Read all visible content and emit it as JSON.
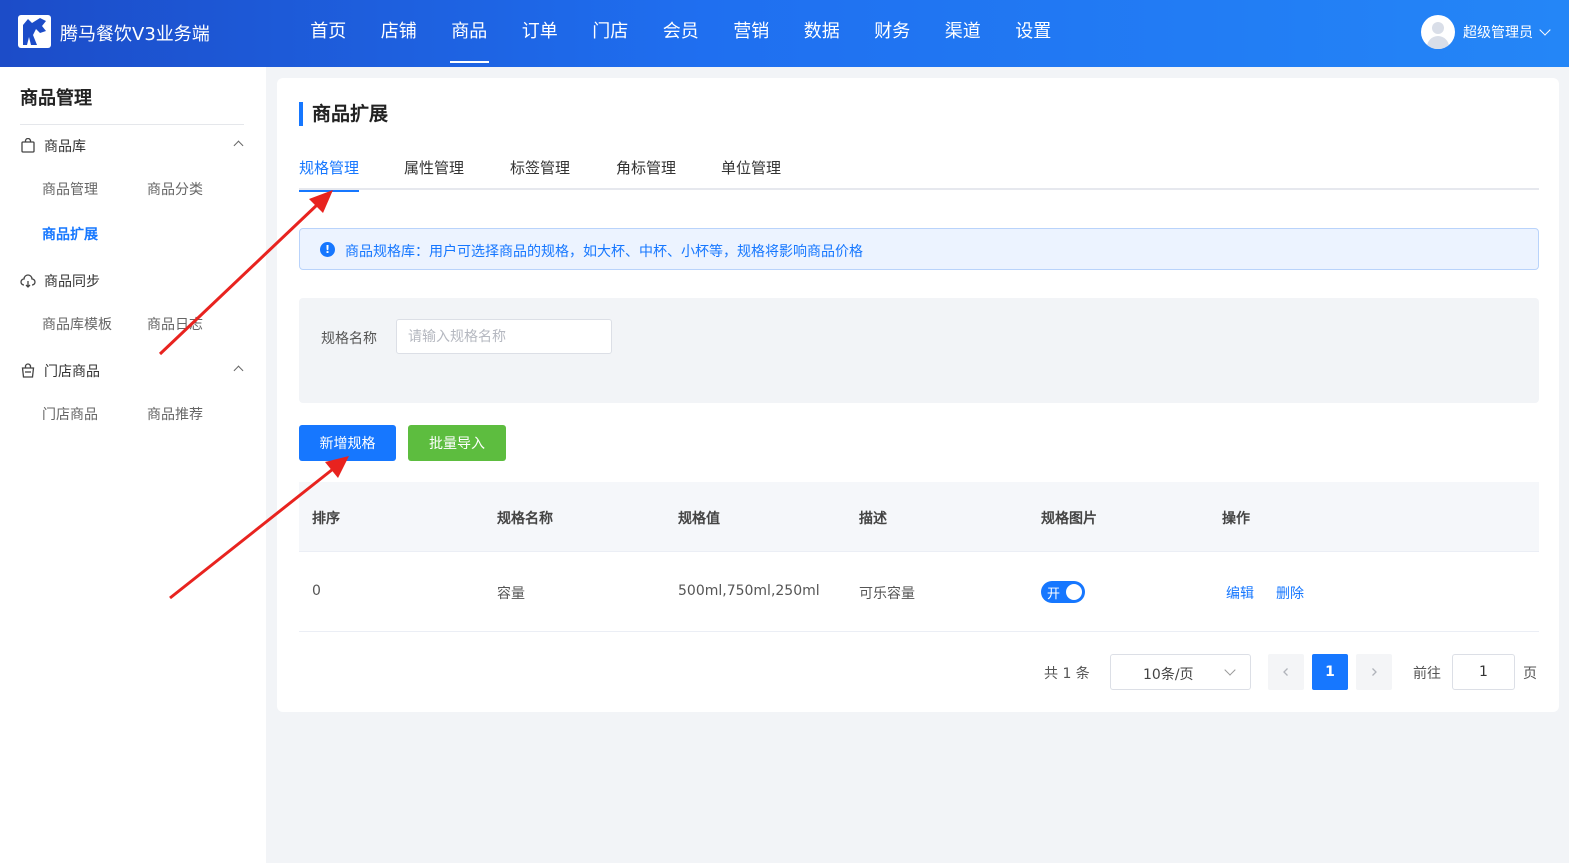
{
  "header": {
    "brand": "腾马餐饮V3业务端",
    "nav": [
      "首页",
      "店铺",
      "商品",
      "订单",
      "门店",
      "会员",
      "营销",
      "数据",
      "财务",
      "渠道",
      "设置"
    ],
    "active_nav": "商品",
    "user_name": "超级管理员"
  },
  "sidebar": {
    "title": "商品管理",
    "groups": [
      {
        "label": "商品库",
        "icon": "shopping-bag-icon",
        "items": [
          "商品管理",
          "商品分类",
          "商品扩展"
        ]
      },
      {
        "label": "商品同步",
        "icon": "cloud-sync-icon",
        "items": [
          "商品库模板",
          "商品日志"
        ]
      },
      {
        "label": "门店商品",
        "icon": "store-bag-icon",
        "items": [
          "门店商品",
          "商品推荐"
        ]
      }
    ],
    "active_item": "商品扩展"
  },
  "page": {
    "title": "商品扩展",
    "tabs": [
      "规格管理",
      "属性管理",
      "标签管理",
      "角标管理",
      "单位管理"
    ],
    "active_tab": "规格管理",
    "alert": "商品规格库：用户可选择商品的规格，如大杯、中杯、小杯等，规格将影响商品价格",
    "filter": {
      "label": "规格名称",
      "placeholder": "请输入规格名称",
      "value": ""
    },
    "buttons": {
      "add": "新增规格",
      "import": "批量导入"
    },
    "table": {
      "headers": [
        "排序",
        "规格名称",
        "规格值",
        "描述",
        "规格图片",
        "操作"
      ],
      "rows": [
        {
          "sort": "0",
          "name": "容量",
          "values": "500ml,750ml,250ml",
          "desc": "可乐容量",
          "image_switch": "开",
          "image_on": true,
          "actions": [
            "编辑",
            "删除"
          ]
        }
      ]
    },
    "pagination": {
      "total": "共 1 条",
      "page_size": "10条/页",
      "current_page": "1",
      "goto_label": "前往",
      "goto_value": "1",
      "page_unit": "页"
    }
  },
  "colors": {
    "primary": "#1677ff",
    "success": "#5dbd3f",
    "annotation_arrow": "#e8231f"
  }
}
